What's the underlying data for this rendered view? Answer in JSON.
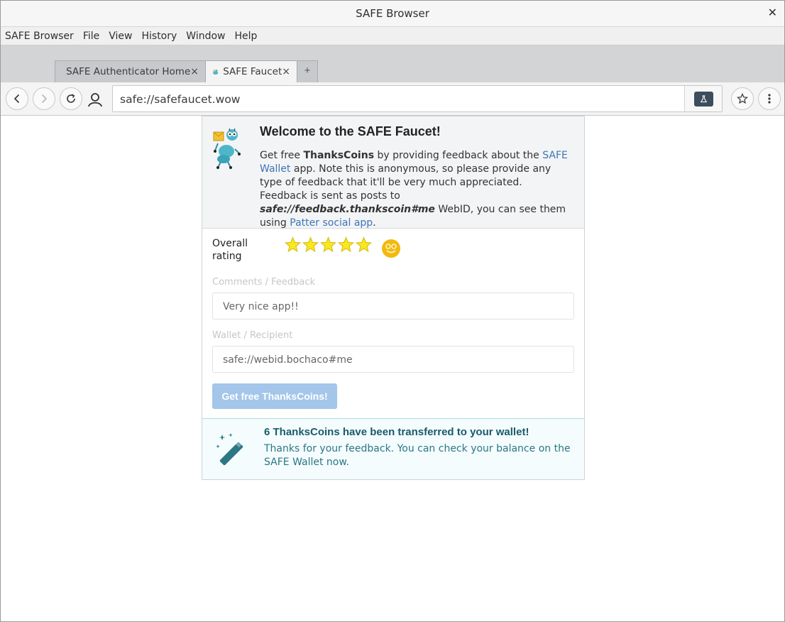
{
  "window": {
    "title": "SAFE Browser"
  },
  "menubar": {
    "items": [
      "SAFE Browser",
      "File",
      "View",
      "History",
      "Window",
      "Help"
    ]
  },
  "tabs": [
    {
      "label": "SAFE Authenticator Home",
      "active": false
    },
    {
      "label": "SAFE Faucet",
      "active": true
    }
  ],
  "newtab": {
    "label": "+"
  },
  "address": {
    "value": "safe://safefaucet.wow"
  },
  "page": {
    "title": "Welcome to the SAFE Faucet!",
    "intro": {
      "t1": "Get free ",
      "b1": "ThanksCoins",
      "t2": " by providing feedback about the ",
      "link1": "SAFE Wallet",
      "t3": " app. Note this is anonymous, so please provide any type of feedback that it'll be very much appreciated. Feedback is sent as posts to ",
      "b2": "safe://feedback.thankscoin#me",
      "t4": " WebID, you can see them using ",
      "link2": "Patter social app",
      "t5": "."
    },
    "rating": {
      "label": "Overall rating",
      "value": 5,
      "max": 5
    },
    "comments": {
      "label": "Comments / Feedback",
      "value": "Very nice app!!"
    },
    "wallet": {
      "label": "Wallet / Recipient",
      "value": "safe://webid.bochaco#me"
    },
    "submit_label": "Get free ThanksCoins!",
    "success": {
      "title": "6 ThanksCoins have been transferred to your wallet!",
      "message": "Thanks for your feedback. You can check your balance on the SAFE Wallet now."
    }
  },
  "colors": {
    "link": "#3f74b8",
    "submit": "#a3c6ea",
    "success_title": "#195b6b",
    "success_text": "#2b7785",
    "star": "#f7e81f",
    "smiley": "#f2b90f"
  }
}
